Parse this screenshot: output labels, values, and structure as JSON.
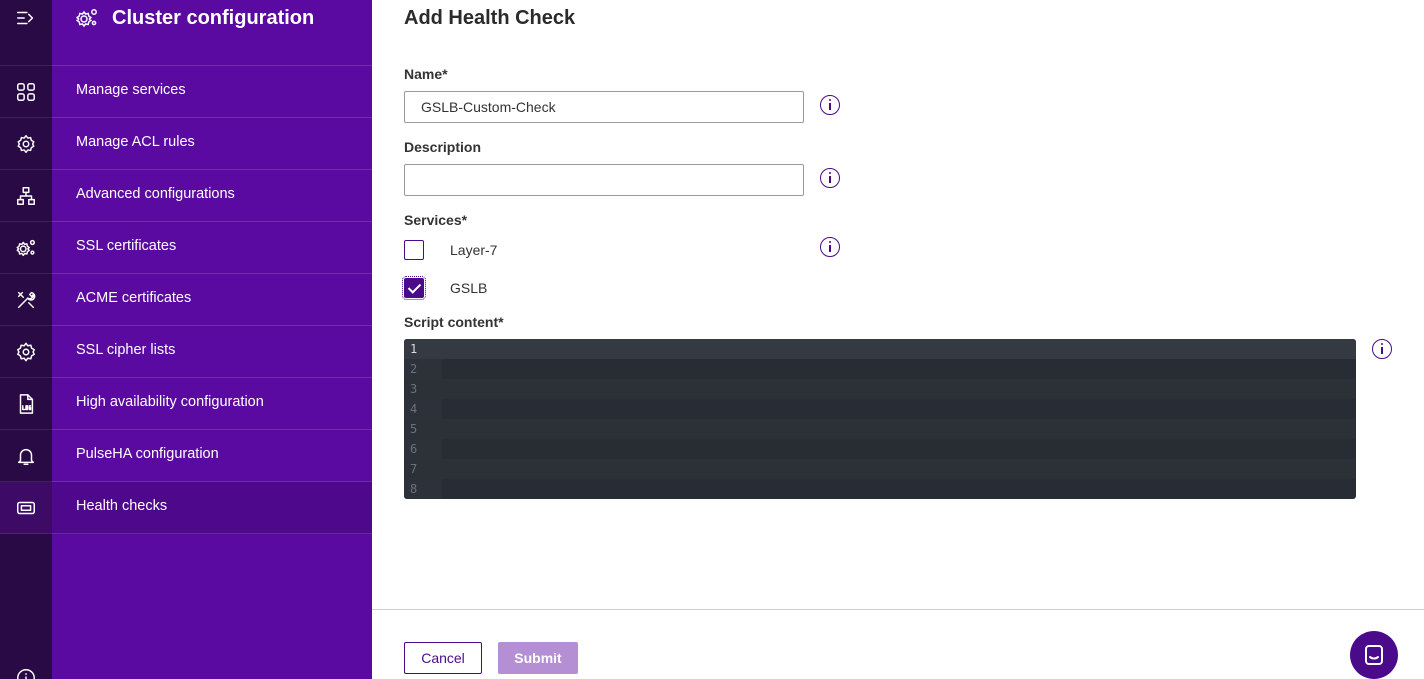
{
  "nav": {
    "title": "Cluster configuration",
    "items": [
      {
        "label": "Manage services",
        "icon": "grid-icon"
      },
      {
        "label": "Manage ACL rules",
        "icon": "shield-gear-icon"
      },
      {
        "label": "Advanced configurations",
        "icon": "network-icon"
      },
      {
        "label": "SSL certificates",
        "icon": "gears-icon"
      },
      {
        "label": "ACME certificates",
        "icon": "tools-icon"
      },
      {
        "label": "SSL cipher lists",
        "icon": "gear-icon"
      },
      {
        "label": "High availability configuration",
        "icon": "log-file-icon"
      },
      {
        "label": "PulseHA configuration",
        "icon": "bell-icon"
      },
      {
        "label": "Health checks",
        "icon": "ticket-icon",
        "active": true
      }
    ]
  },
  "form": {
    "title": "Add Health Check",
    "name_label": "Name*",
    "name_value": "GSLB-Custom-Check",
    "description_label": "Description",
    "description_value": "",
    "services_label": "Services*",
    "services": [
      {
        "label": "Layer-7",
        "checked": false
      },
      {
        "label": "GSLB",
        "checked": true
      }
    ],
    "script_label": "Script content*",
    "line_numbers": [
      "1",
      "2",
      "3",
      "4",
      "5",
      "6",
      "7",
      "8"
    ],
    "cancel_label": "Cancel",
    "submit_label": "Submit"
  },
  "colors": {
    "rail": "#2a0a45",
    "nav": "#5a0aa0",
    "accent": "#4a0a8a",
    "submit_disabled": "#b48fd3",
    "editor_bg": "#282c34"
  }
}
